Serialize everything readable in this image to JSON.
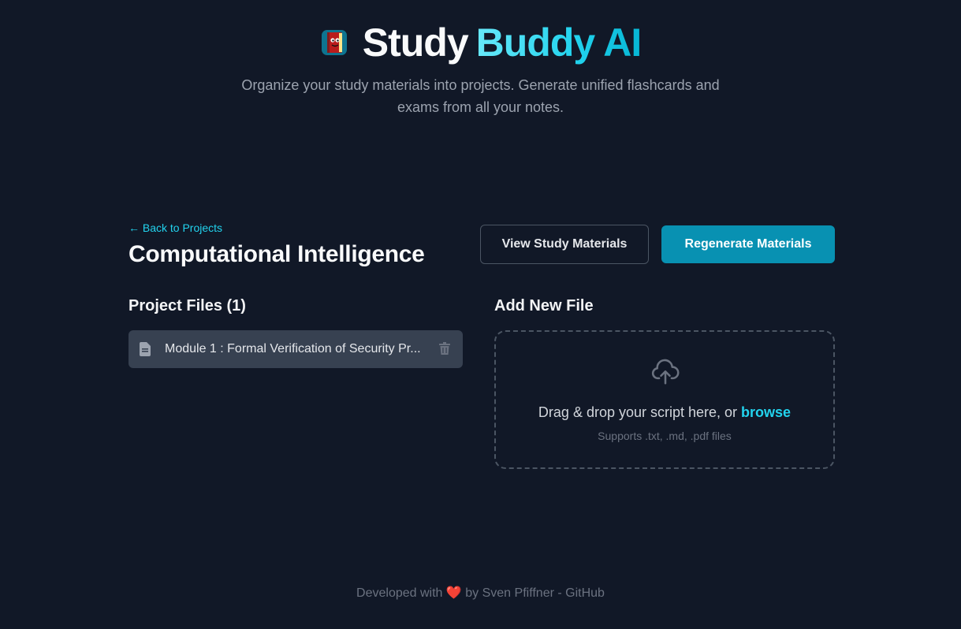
{
  "header": {
    "title_part1": "Study",
    "title_part2": "Buddy AI",
    "logo_icon": "book-icon",
    "subtitle": "Organize your study materials into projects. Generate unified flashcards and exams from all your notes."
  },
  "project": {
    "back_label": "← Back to Projects",
    "title": "Computational Intelligence",
    "view_button": "View Study Materials",
    "regenerate_button": "Regenerate Materials"
  },
  "files": {
    "title": "Project Files (1)",
    "items": [
      {
        "name": "Module 1 : Formal Verification of Security Pr...",
        "icon": "file-icon",
        "delete_icon": "trash-icon"
      }
    ]
  },
  "upload": {
    "title": "Add New File",
    "icon": "cloud-upload-icon",
    "drop_text": "Drag & drop your script here, or",
    "browse_label": "browse",
    "hint": "Supports .txt, .md, .pdf files"
  },
  "footer": {
    "prefix": "Developed with",
    "heart": "❤️",
    "by": "by Sven Pfiffner -",
    "link": "GitHub"
  },
  "colors": {
    "background": "#111827",
    "accent": "#22d3ee",
    "primary_button": "#0891b2",
    "file_item_bg": "#374151"
  }
}
